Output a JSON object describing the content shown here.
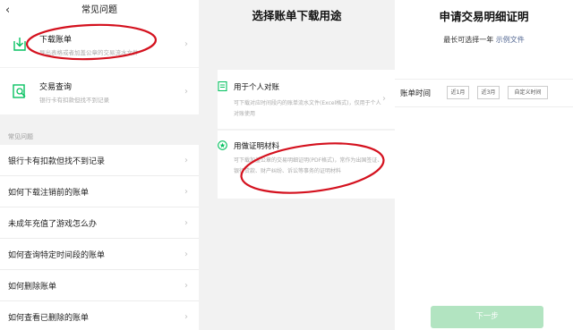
{
  "panel1": {
    "title": "常见问题",
    "back_icon": "back-chevron-icon",
    "items": [
      {
        "icon": "download-icon",
        "title": "下载账单",
        "desc": "导出表格或者加盖公章的交易流水文件"
      },
      {
        "icon": "search-document-icon",
        "title": "交易查询",
        "desc": "银行卡有扣款但找不到记录"
      }
    ],
    "section_label": "常见问题",
    "faqs": [
      "银行卡有扣款但找不到记录",
      "如何下载注销前的账单",
      "未成年充值了游戏怎么办",
      "如何查询特定时间段的账单",
      "如何删除账单",
      "如何查看已删除的账单"
    ]
  },
  "panel2": {
    "title": "选择账单下载用途",
    "options": [
      {
        "icon": "document-icon",
        "title": "用于个人对账",
        "desc": "可下载对应时间段内的账单流水文件(Excel格式)，仅用于个人对账使用"
      },
      {
        "icon": "star-icon",
        "title": "用做证明材料",
        "desc": "可下载加盖公章的交易明细证明(PDF格式)，常作为出国签证、银行贷款、财产纠纷、诉讼等事务的证明材料"
      }
    ]
  },
  "panel3": {
    "title": "申请交易明细证明",
    "subtitle": "最长可选择一年",
    "sample_link": "示例文件",
    "period_label": "账单时间",
    "chips": [
      "近1月",
      "近3月",
      "自定义时间"
    ],
    "next_button": "下一步"
  },
  "colors": {
    "brand_green": "#07c160",
    "annotation_red": "#d4111e",
    "link": "#576b95"
  }
}
